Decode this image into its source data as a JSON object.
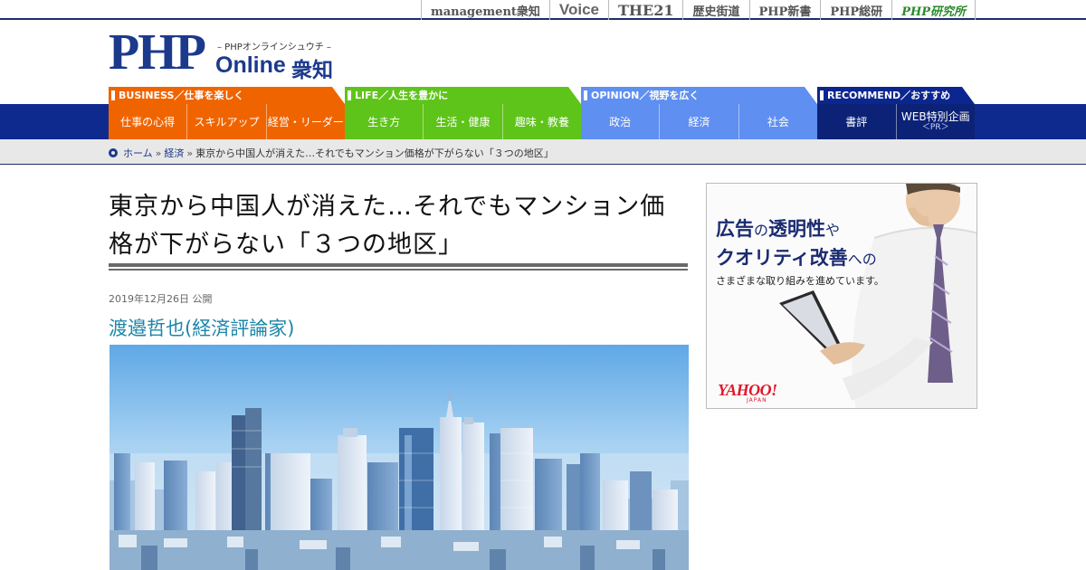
{
  "top_links": [
    {
      "label": "management衆知",
      "cls": ""
    },
    {
      "label": "Voice",
      "cls": "voice"
    },
    {
      "label": "THE21",
      "cls": "the21"
    },
    {
      "label": "歴史街道",
      "cls": ""
    },
    {
      "label": "PHP新書",
      "cls": ""
    },
    {
      "label": "PHP総研",
      "cls": ""
    },
    {
      "label": "PHP研究所",
      "cls": "php-inst"
    }
  ],
  "logo": {
    "php": "PHP",
    "sub": "– PHPオンラインシュウチ –",
    "online": "Online",
    "jp": "衆知"
  },
  "nav": {
    "business": {
      "head": "BUSINESS／仕事を楽しく",
      "items": [
        "仕事の心得",
        "スキルアップ",
        "経営・リーダー"
      ]
    },
    "life": {
      "head": "LIFE／人生を豊かに",
      "items": [
        "生き方",
        "生活・健康",
        "趣味・教養"
      ]
    },
    "opinion": {
      "head": "OPINION／視野を広く",
      "items": [
        "政治",
        "経済",
        "社会"
      ]
    },
    "recommend": {
      "head": "RECOMMEND／おすすめ",
      "items": [
        "書評",
        "WEB特別企画"
      ],
      "pr": "＜PR＞"
    }
  },
  "breadcrumb": {
    "home": "ホーム",
    "sep1": "»",
    "category": "経済",
    "sep2": "»",
    "current": "東京から中国人が消えた…それでもマンション価格が下がらない「３つの地区」"
  },
  "article": {
    "title": "東京から中国人が消えた…それでもマンション価格が下がらない「３つの地区」",
    "date": "2019年12月26日 公開",
    "author": "渡邉哲也(経済評論家)"
  },
  "ad": {
    "l1a": "広告",
    "l1b": "の",
    "l1c": "透明性",
    "l1d": "や",
    "l2a": "クオリティ改善",
    "l2b": "への",
    "l3": "さまざまな取り組みを進めています。",
    "brand": "YAHOO!",
    "brand_sub": "JAPAN"
  },
  "colors": {
    "business": "#f06400",
    "life": "#5fc41a",
    "opinion": "#5f8ff0",
    "recommend": "#0c2276",
    "nav_bar": "#0f2a8f",
    "author": "#1c86a8"
  }
}
